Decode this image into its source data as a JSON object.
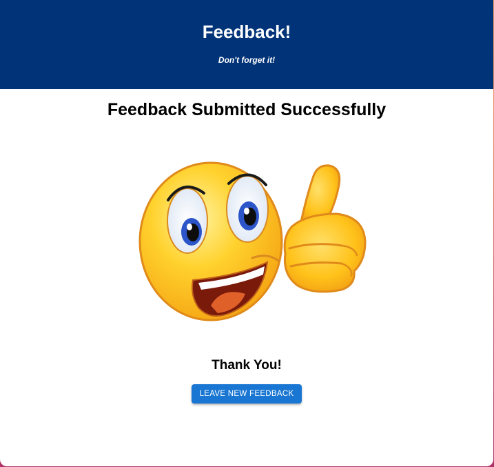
{
  "header": {
    "title": "Feedback!",
    "subtitle": "Don't forget it!"
  },
  "main": {
    "title": "Feedback Submitted Successfully",
    "illustration": "thumbs-up-smiley-icon",
    "thanks": "Thank You!",
    "button_label": "LEAVE NEW FEEDBACK"
  },
  "colors": {
    "header_bg": "#003377",
    "button_bg": "#1976d2",
    "emoji_yellow": "#ffc21a",
    "emoji_outline": "#e08a1a"
  }
}
